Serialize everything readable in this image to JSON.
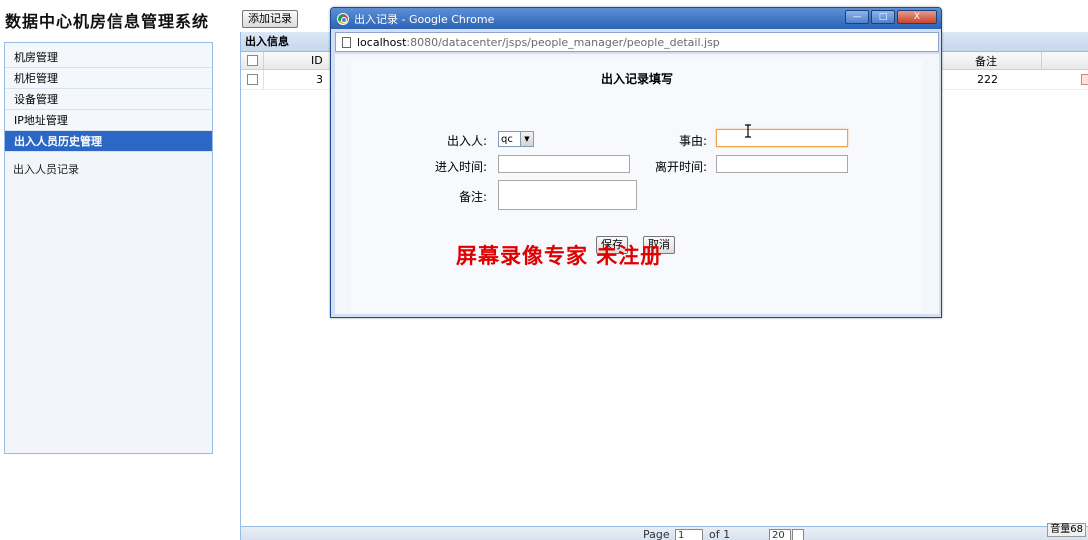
{
  "app": {
    "title": "数据中心机房信息管理系统",
    "add_button": "添加记录"
  },
  "sidebar": {
    "items": [
      {
        "label": "机房管理"
      },
      {
        "label": "机柜管理"
      },
      {
        "label": "设备管理"
      },
      {
        "label": "IP地址管理"
      },
      {
        "label": "出入人员历史管理",
        "active": true
      }
    ],
    "sub_items": [
      {
        "label": "出入人员记录"
      }
    ]
  },
  "grid": {
    "title": "出入信息",
    "columns": {
      "id": "ID",
      "remark": "备注"
    },
    "rows": [
      {
        "id": "3",
        "remark": "222"
      }
    ],
    "pager": {
      "page_label": "Page",
      "page_value": "1",
      "of_label": "of 1",
      "page_size": "20"
    }
  },
  "popup": {
    "window_title": "出入记录 - Google Chrome",
    "url_host": "localhost",
    "url_rest": ":8080/datacenter/jsps/people_manager/people_detail.jsp",
    "form": {
      "title": "出入记录填写",
      "person_label": "出入人:",
      "person_value": "qc",
      "reason_label": "事由:",
      "enter_time_label": "进入时间:",
      "leave_time_label": "离开时间:",
      "remark_label": "备注:",
      "save_label": "保存",
      "cancel_label": "取消"
    }
  },
  "overlay": {
    "watermark": "屏幕录像专家 未注册",
    "volume": "音量68"
  },
  "colors": {
    "accent": "#2c67c6",
    "titlebar": "#2b63b6",
    "watermark": "#e00000",
    "focus_border": "#e8a54a"
  }
}
